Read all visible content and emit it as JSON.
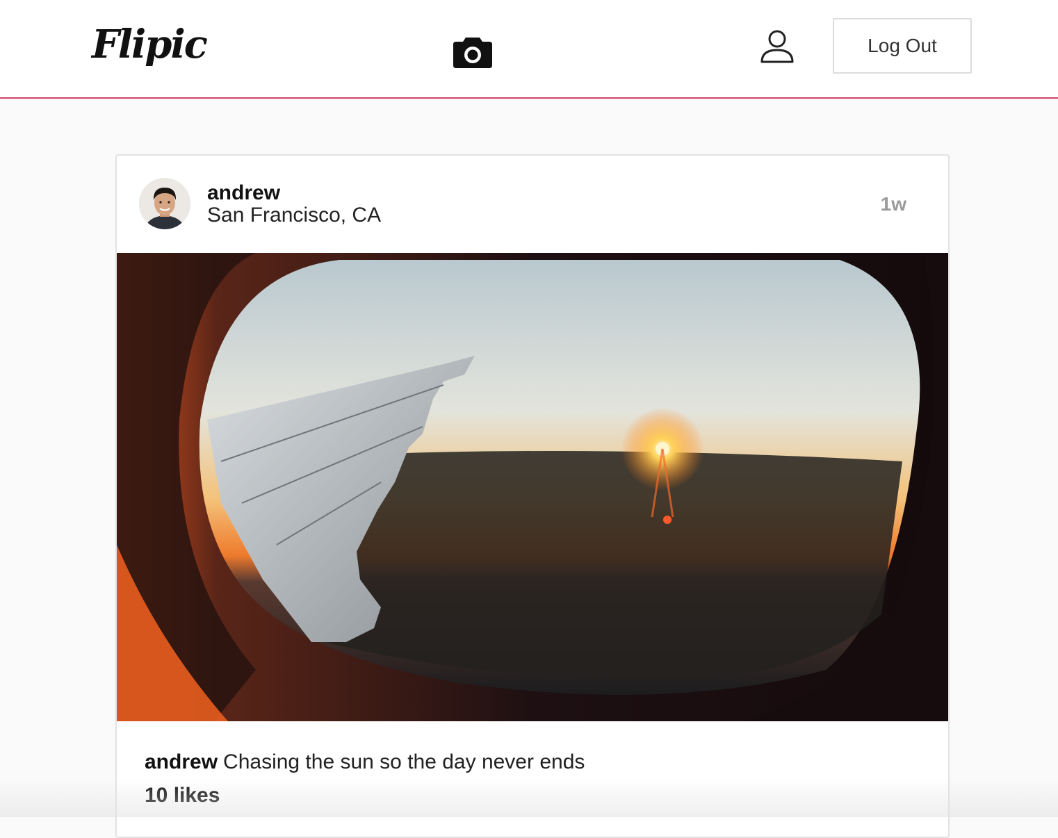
{
  "navbar": {
    "logo_text": "Flipic",
    "camera_icon": "camera-icon",
    "profile_icon": "user-icon",
    "logout_label": "Log Out",
    "accent_color": "#d0426a"
  },
  "post": {
    "username": "andrew",
    "location": "San Francisco, CA",
    "time_ago": "1w",
    "image_subject": "sunset-airplane-window-photo",
    "caption_user": "andrew",
    "caption_text": "Chasing the sun so the day never ends",
    "likes": "10 likes"
  }
}
